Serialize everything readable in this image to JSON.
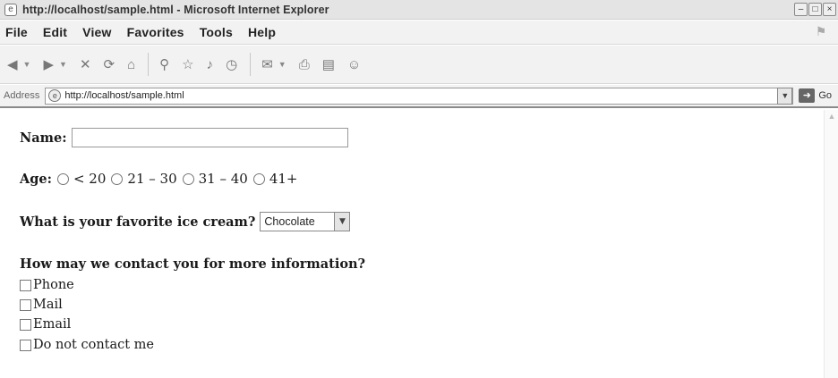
{
  "window": {
    "title": "http://localhost/sample.html - Microsoft Internet Explorer",
    "app_icon": "ie-page-icon",
    "buttons": {
      "minimize": "–",
      "maximize": "□",
      "close": "×"
    }
  },
  "menubar": {
    "items": [
      "File",
      "Edit",
      "View",
      "Favorites",
      "Tools",
      "Help"
    ]
  },
  "toolbar": {
    "icons": [
      "back-icon",
      "forward-icon",
      "stop-icon",
      "refresh-icon",
      "home-icon",
      "search-icon",
      "favorites-icon",
      "media-icon",
      "history-icon",
      "mail-icon",
      "print-icon",
      "edit-icon",
      "messenger-icon"
    ]
  },
  "addressbar": {
    "label": "Address",
    "url": "http://localhost/sample.html",
    "go_label": "Go"
  },
  "form": {
    "name_label": "Name:",
    "name_value": "",
    "age_label": "Age:",
    "age_options": [
      "< 20",
      "21 – 30",
      "31 – 40",
      "41+"
    ],
    "icecream_label": "What is your favorite ice cream?",
    "icecream_selected": "Chocolate",
    "contact_label": "How may we contact you for more information?",
    "contact_options": [
      "Phone",
      "Mail",
      "Email",
      "Do not contact me"
    ]
  }
}
